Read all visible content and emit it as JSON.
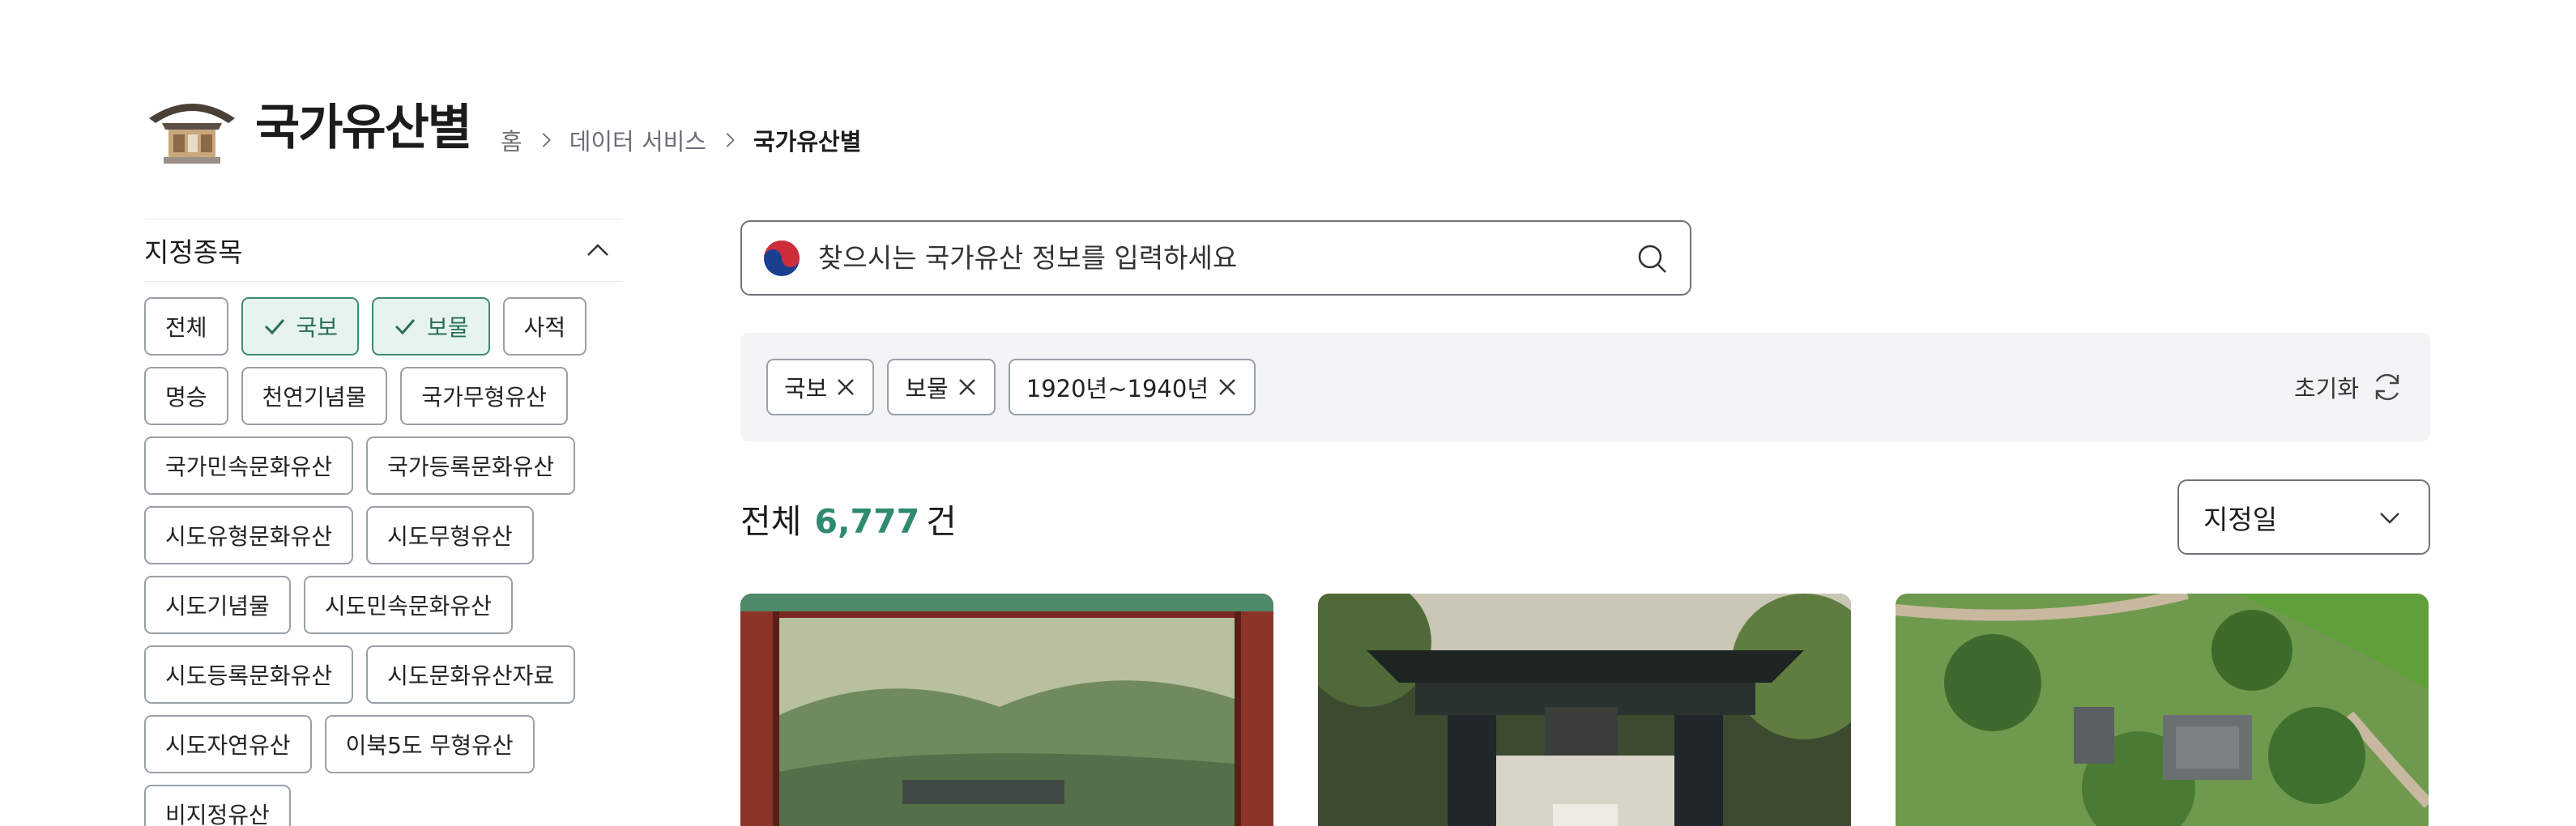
{
  "header": {
    "logo_icon": "traditional-house-icon",
    "title": "국가유산별",
    "breadcrumb": [
      "홈",
      "데이터 서비스",
      "국가유산별"
    ]
  },
  "filter": {
    "title": "지정종목",
    "chips": [
      {
        "label": "전체",
        "selected": false
      },
      {
        "label": "국보",
        "selected": true
      },
      {
        "label": "보물",
        "selected": true
      },
      {
        "label": "사적",
        "selected": false
      },
      {
        "label": "명승",
        "selected": false
      },
      {
        "label": "천연기념물",
        "selected": false
      },
      {
        "label": "국가무형유산",
        "selected": false
      },
      {
        "label": "국가민속문화유산",
        "selected": false
      },
      {
        "label": "국가등록문화유산",
        "selected": false
      },
      {
        "label": "시도유형문화유산",
        "selected": false
      },
      {
        "label": "시도무형유산",
        "selected": false
      },
      {
        "label": "시도기념물",
        "selected": false
      },
      {
        "label": "시도민속문화유산",
        "selected": false
      },
      {
        "label": "시도등록문화유산",
        "selected": false
      },
      {
        "label": "시도문화유산자료",
        "selected": false
      },
      {
        "label": "시도자연유산",
        "selected": false
      },
      {
        "label": "이북5도 무형유산",
        "selected": false
      },
      {
        "label": "비지정유산",
        "selected": false
      }
    ]
  },
  "search": {
    "placeholder": "찾으시는 국가유산 정보를 입력하세요",
    "value": ""
  },
  "active_filters": {
    "tags": [
      "국보",
      "보물",
      "1920년~1940년"
    ],
    "reset_label": "초기화"
  },
  "results": {
    "total_prefix": "전체",
    "total_count": "6,777",
    "total_suffix": "건",
    "sort_value": "지정일"
  },
  "colors": {
    "accent": "#2f8a70",
    "chip_selected_bg": "#e6f3ee",
    "filter_bar_bg": "#f3f4f6"
  }
}
